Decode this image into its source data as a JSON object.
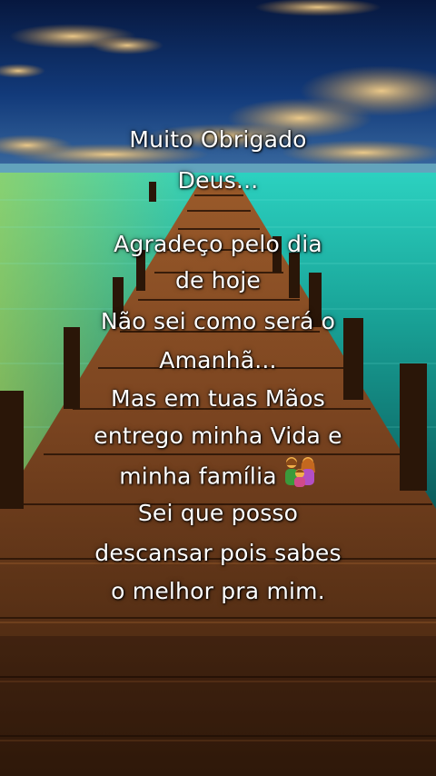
{
  "lines": [
    "Muito Obrigado",
    "Deus...",
    "Agradeço pelo dia",
    "de hoje",
    "Não sei como será o",
    "Amanhã...",
    "Mas em tuas Mãos",
    "entrego minha Vida e",
    "minha família",
    "Sei que posso",
    "descansar pois sabes",
    "o melhor pra mim."
  ],
  "icons": {
    "family_emoji": "family-icon"
  },
  "colors": {
    "text": "#ffffff",
    "sky": "#0d2a63",
    "sea": "#1fb3a4",
    "cloud": "#e9b45a",
    "pier_wood": "#6b3d1f"
  }
}
